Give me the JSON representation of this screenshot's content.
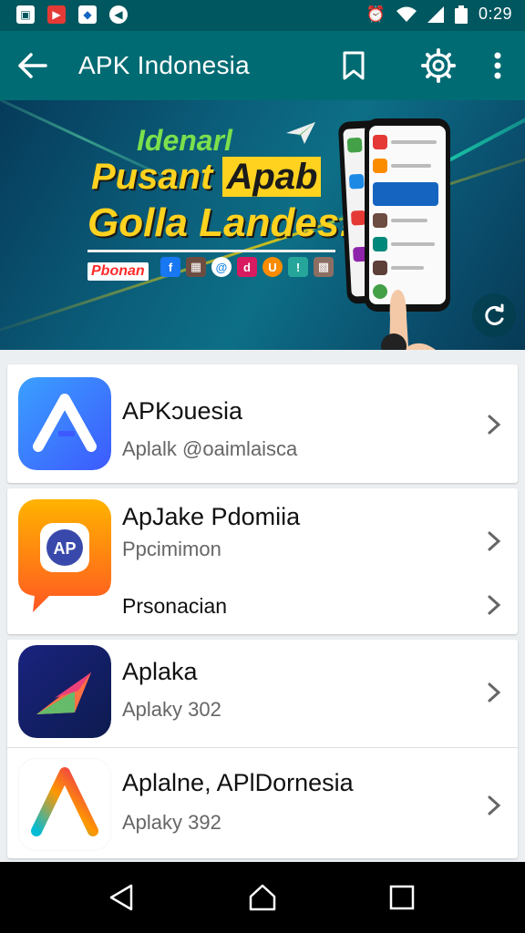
{
  "status_bar": {
    "time": "0:29",
    "icons": [
      "gallery-icon",
      "video-icon",
      "image-icon",
      "messenger-icon",
      "alarm-icon",
      "wifi-icon",
      "signal-icon",
      "battery-icon"
    ]
  },
  "app_bar": {
    "title": "APK Indonesia",
    "icons": [
      "back-arrow-icon",
      "bookmark-icon",
      "settings-icon",
      "more-vert-icon"
    ]
  },
  "banner": {
    "line1": "Idenarl",
    "line2_part1": "Pusant ",
    "line2_highlight": "Apab",
    "line3": "Golla Landes!",
    "tag": "Pbonan",
    "socials": [
      "f",
      "@",
      "d",
      "U",
      "!"
    ]
  },
  "apps": [
    {
      "title": "APKɔuesia",
      "subtitle": "Aplalk @oaimlaisca",
      "icon": "apk-a-icon"
    },
    {
      "title": "ApJake Pdomiia",
      "subtitle": "Ppcimimon",
      "extra": "Prsonacian",
      "icon": "ap-chat-icon"
    },
    {
      "title": "Aplaka",
      "subtitle": "Aplaky 302",
      "icon": "play-arrow-icon"
    },
    {
      "title": "Aplalne, APlDornesia",
      "subtitle": "Aplaky 392",
      "icon": "gradient-a-icon"
    }
  ],
  "nav_bar": {
    "icons": [
      "back-triangle-icon",
      "home-icon",
      "recents-icon"
    ]
  },
  "colors": {
    "status_bar": "#00575f",
    "app_bar": "#006b73",
    "accent_yellow": "#ffd21f",
    "accent_green": "#7be04c",
    "background": "#eceff1"
  }
}
